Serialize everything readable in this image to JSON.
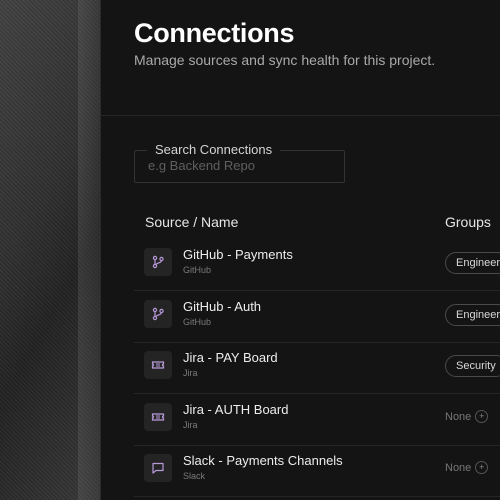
{
  "header": {
    "title": "Connections",
    "subtitle": "Manage sources and sync health for this project."
  },
  "search": {
    "label": "Search Connections",
    "placeholder": "e.g Backend Repo"
  },
  "table": {
    "columns": [
      "Source / Name",
      "Groups"
    ],
    "rows": [
      {
        "name": "GitHub - Payments",
        "source": "GitHub",
        "icon": "git-branch-icon",
        "group": "Engineer",
        "has_group": true
      },
      {
        "name": "GitHub - Auth",
        "source": "GitHub",
        "icon": "git-branch-icon",
        "group": "Engineer",
        "has_group": true
      },
      {
        "name": "Jira - PAY Board",
        "source": "Jira",
        "icon": "ticket-icon",
        "group": "Security",
        "has_group": true
      },
      {
        "name": "Jira - AUTH Board",
        "source": "Jira",
        "icon": "ticket-icon",
        "group": "None",
        "has_group": false
      },
      {
        "name": "Slack - Payments Channels",
        "source": "Slack",
        "icon": "message-icon",
        "group": "None",
        "has_group": false
      }
    ]
  },
  "colors": {
    "icon_accent": "#b79ad9",
    "background": "#141414"
  }
}
